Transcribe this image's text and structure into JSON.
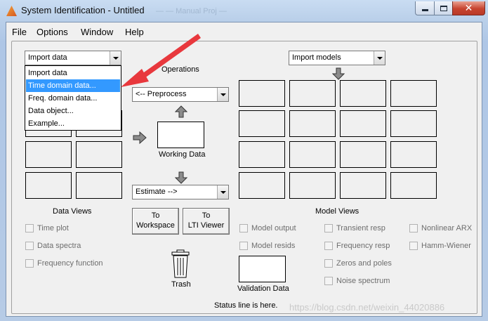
{
  "window": {
    "title": "System Identification - Untitled",
    "background_title_1": "— — Manual Proj —",
    "min_icon": "minimize-icon",
    "max_icon": "maximize-icon",
    "close_icon": "close-icon",
    "close_glyph": "✕"
  },
  "menubar": {
    "items": [
      {
        "label": "File"
      },
      {
        "label": "Options"
      },
      {
        "label": "Window"
      },
      {
        "label": "Help"
      }
    ]
  },
  "data_panel": {
    "import_select": {
      "value": "Import data"
    },
    "dropdown_options": [
      {
        "label": "Import data",
        "selected": false
      },
      {
        "label": "Time domain data...",
        "selected": true
      },
      {
        "label": "Freq. domain data...",
        "selected": false
      },
      {
        "label": "Data object...",
        "selected": false
      },
      {
        "label": "Example...",
        "selected": false
      }
    ],
    "heading": "Data Views",
    "checkboxes": [
      {
        "label": "Time plot",
        "checked": false
      },
      {
        "label": "Data spectra",
        "checked": false
      },
      {
        "label": "Frequency function",
        "checked": false
      }
    ]
  },
  "operations": {
    "heading": "Operations",
    "preprocess_select": {
      "value": "<-- Preprocess"
    },
    "working_data_label": "Working Data",
    "estimate_select": {
      "value": "Estimate -->"
    },
    "to_workspace": {
      "line1": "To",
      "line2": "Workspace"
    },
    "to_lti_viewer": {
      "line1": "To",
      "line2": "LTI Viewer"
    },
    "trash_label": "Trash",
    "trash_icon": "trash-icon"
  },
  "models_panel": {
    "import_select": {
      "value": "Import models"
    },
    "heading": "Model Views",
    "checkboxes": [
      {
        "label": "Model output",
        "checked": false
      },
      {
        "label": "Transient resp",
        "checked": false
      },
      {
        "label": "Nonlinear ARX",
        "checked": false
      },
      {
        "label": "Model resids",
        "checked": false
      },
      {
        "label": "Frequency resp",
        "checked": false
      },
      {
        "label": "Hamm-Wiener",
        "checked": false
      },
      {
        "label": "Zeros and poles",
        "checked": false
      },
      {
        "label": "Noise spectrum",
        "checked": false
      }
    ],
    "validation_label": "Validation Data"
  },
  "status": {
    "text": "Status line is here."
  },
  "watermark": {
    "text": "https://blog.csdn.net/weixin_44020886"
  },
  "annotation": {
    "color": "#e8383d",
    "icon": "red-annotation-arrow"
  }
}
